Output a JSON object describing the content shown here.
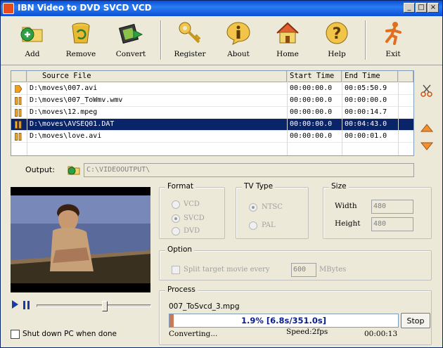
{
  "window": {
    "title": "IBN Video to DVD SVCD VCD",
    "controls": {
      "minimize": "_",
      "maximize": "□",
      "close": "×"
    }
  },
  "toolbar": {
    "add": "Add",
    "remove": "Remove",
    "convert": "Convert",
    "register": "Register",
    "about": "About",
    "home": "Home",
    "help": "Help",
    "exit": "Exit"
  },
  "filelist": {
    "columns": {
      "source": "Source File",
      "start": "Start Time",
      "end": "End Time"
    },
    "rows": [
      {
        "source": "D:\\moves\\007.avi",
        "start": "00:00:00.0",
        "end": "00:05:50.9",
        "status": "playing"
      },
      {
        "source": "D:\\moves\\007_ToWmv.wmv",
        "start": "00:00:00.0",
        "end": "00:00:00.0",
        "status": "paused"
      },
      {
        "source": "D:\\moves\\12.mpeg",
        "start": "00:00:00.0",
        "end": "00:00:14.7",
        "status": "paused"
      },
      {
        "source": "D:\\moves\\AVSEQ01.DAT",
        "start": "00:00:00.0",
        "end": "00:04:43.0",
        "status": "paused"
      },
      {
        "source": "D:\\moves\\love.avi",
        "start": "00:00:00.0",
        "end": "00:00:01.0",
        "status": "paused"
      }
    ],
    "selected_row": 3
  },
  "output": {
    "label": "Output:",
    "path": "C:\\VIDEOOUTPUT\\"
  },
  "player": {
    "seek_fraction": 0.6
  },
  "shutdown": {
    "label": "Shut down PC when done",
    "checked": false
  },
  "format": {
    "title": "Format",
    "options": [
      "VCD",
      "SVCD",
      "DVD"
    ],
    "selected": "SVCD"
  },
  "tv_type": {
    "title": "TV Type",
    "options": [
      "NTSC",
      "PAL"
    ],
    "selected": "NTSC"
  },
  "size": {
    "title": "Size",
    "width_label": "Width",
    "width_value": "480",
    "height_label": "Height",
    "height_value": "480"
  },
  "option": {
    "title": "Option",
    "split_label": "Split target movie every",
    "split_value": "600",
    "split_unit": "MBytes"
  },
  "process": {
    "title": "Process",
    "filename": "007_ToSvcd_3.mpg",
    "progress_text": "1.9% [6.8s/351.0s]",
    "progress_fraction": 0.019,
    "status": "Converting...",
    "speed": "Speed:2fps",
    "elapsed": "00:00:13",
    "stop_label": "Stop"
  },
  "colors": {
    "titlebar": "#0a4ed8",
    "selection": "#0a246a",
    "progress_fill": "#c87a58",
    "progress_text": "#0a1e8c"
  }
}
